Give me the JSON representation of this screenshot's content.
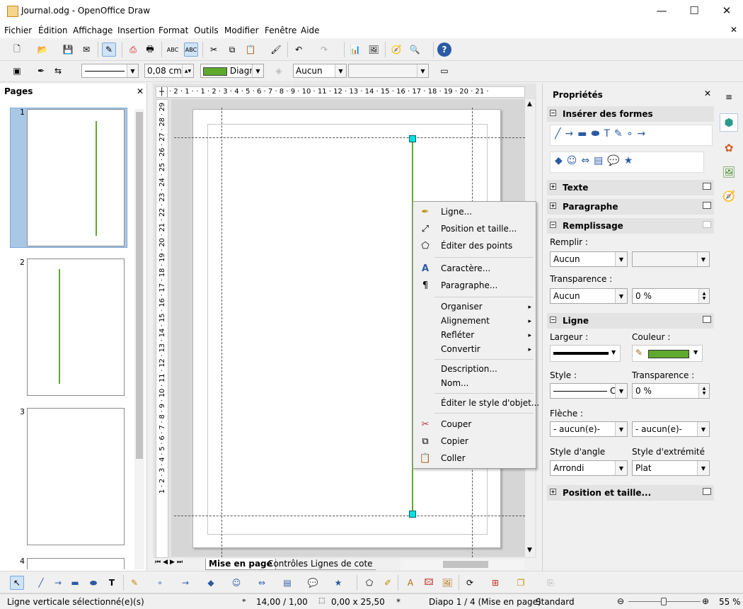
{
  "window": {
    "title": "Journal.odg - OpenOffice Draw",
    "minimize": "—",
    "maximize": "☐",
    "close": "✕"
  },
  "menu": [
    "Fichier",
    "Édition",
    "Affichage",
    "Insertion",
    "Format",
    "Outils",
    "Modifier",
    "Fenêtre",
    "Aide"
  ],
  "menu_close": "✕",
  "toolbar2": {
    "line_width": "0,08 cm",
    "color_name": "Diagra",
    "area_style": "Aucun",
    "area_value": ""
  },
  "pages_panel": {
    "title": "Pages",
    "close": "✕",
    "pages": [
      "1",
      "2",
      "3",
      "4"
    ]
  },
  "ruler_h": "· 2 · 1 ·  · 1 · 2 · 3 · 4 · 5 · 6 · 7 · 8 · 9 · 10 · 11 · 12 · 13 · 14 · 15 · 16 · 17 · 18 · 19 · 20 · 21 ·",
  "ruler_v": "1 · 2 · 3 · 4 · 5 · 6 · 7 · 8 · 9 · 10 · 11 · 12 · 13 · 14 · 15 · 16 · 17 · 18 · 19 · 20 · 21 · 22 · 23 · 24 · 25 · 26 · 27 · 28 · 29",
  "context_menu": {
    "line": "Ligne...",
    "position_size": "Position et taille...",
    "edit_points": "Éditer des points",
    "character": "Caractère...",
    "paragraph": "Paragraphe...",
    "arrange": "Organiser",
    "alignment": "Alignement",
    "flip": "Refléter",
    "convert": "Convertir",
    "description": "Description...",
    "name": "Nom...",
    "edit_style": "Éditer le style d'objet...",
    "cut": "Couper",
    "copy": "Copier",
    "paste": "Coller"
  },
  "tabs": [
    "Mise en page",
    "Contrôles",
    "Lignes de cote"
  ],
  "properties": {
    "title": "Propriétés",
    "close": "✕",
    "insert_shapes": "Insérer des formes",
    "text": "Texte",
    "paragraph": "Paragraphe",
    "fill": "Remplissage",
    "fill_label": "Remplir :",
    "fill_value": "Aucun",
    "fill_value2": "",
    "transparency_label": "Transparence :",
    "transparency_value": "Aucun",
    "transparency_pct": "0 %",
    "line": "Ligne",
    "width_label": "Largeur :",
    "color_label": "Couleur :",
    "style_label": "Style :",
    "line_transparency_label": "Transparence :",
    "line_transparency_pct": "0 %",
    "arrow_label": "Flèche :",
    "arrow_start": "- aucun(e)-",
    "arrow_end": "- aucun(e)-",
    "corner_label": "Style d'angle",
    "corner_value": "Arrondi",
    "cap_label": "Style d'extrémité",
    "cap_value": "Plat",
    "position_size": "Position et taille..."
  },
  "status": {
    "message": "Ligne verticale sélectionné(e)(s)",
    "position": "14,00 / 1,00",
    "size": "0,00 x 25,50",
    "modified": "*",
    "slide": "Diapo 1 / 4 (Mise en page)",
    "style": "Standard",
    "zoom": "55 %"
  },
  "colors": {
    "line": "#5fa92c",
    "handle": "#00e0e0",
    "thumb_selected": "#a9c8e6"
  }
}
